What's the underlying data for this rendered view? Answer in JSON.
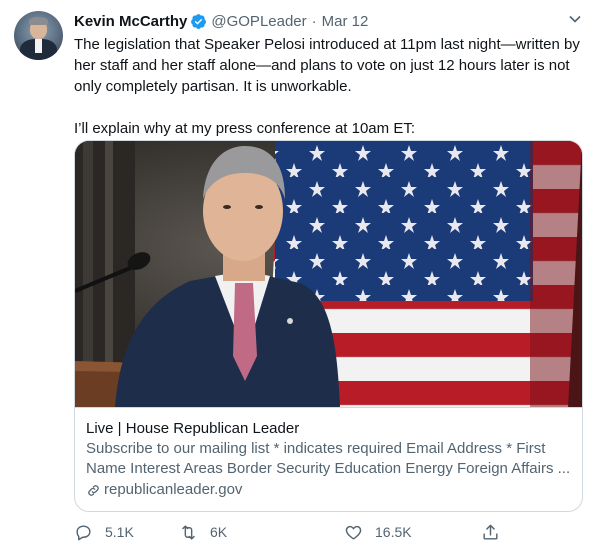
{
  "tweet": {
    "author_name": "Kevin McCarthy",
    "handle": "@GOPLeader",
    "separator": "·",
    "date": "Mar 12",
    "verified": true,
    "paragraph1": "The legislation that Speaker Pelosi introduced at 11pm last night—written by her staff and her staff alone—and plans to vote on just 12 hours later is not only completely partisan. It is unworkable.",
    "paragraph2": "I’ll explain why at my press conference at 10am ET:"
  },
  "card": {
    "title": "Live | House Republican Leader",
    "description": "Subscribe to our mailing list * indicates required Email Address * First Name Interest Areas Border Security Education Energy Foreign Affairs ...",
    "domain": "republicanleader.gov"
  },
  "actions": {
    "replies": "5.1K",
    "retweets": "6K",
    "likes": "16.5K"
  },
  "colors": {
    "verified_blue": "#1d9bf0",
    "muted_text": "#536471",
    "border": "#cfd9de"
  },
  "icons": [
    "verified-badge-icon",
    "chevron-down-icon",
    "link-icon",
    "reply-icon",
    "retweet-icon",
    "like-icon",
    "share-icon"
  ]
}
